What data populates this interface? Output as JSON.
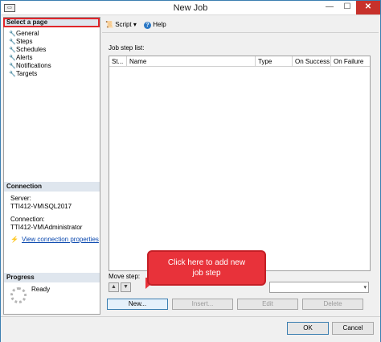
{
  "window": {
    "title": "New Job",
    "app_icon": "dialog-icon",
    "min_glyph": "—",
    "max_glyph": "☐",
    "close_glyph": "✕"
  },
  "left": {
    "select_page_header": "Select a page",
    "pages": [
      {
        "label": "General"
      },
      {
        "label": "Steps"
      },
      {
        "label": "Schedules"
      },
      {
        "label": "Alerts"
      },
      {
        "label": "Notifications"
      },
      {
        "label": "Targets"
      }
    ],
    "connection_header": "Connection",
    "server_label": "Server:",
    "server_value": "TTI412-VM\\SQL2017",
    "connection_label": "Connection:",
    "connection_value": "TTI412-VM\\Administrator",
    "view_connection_link": "View connection properties",
    "progress_header": "Progress",
    "progress_status": "Ready"
  },
  "toolbar": {
    "script_label": "Script",
    "help_label": "Help"
  },
  "steps": {
    "list_label": "Job step list:",
    "columns": [
      "St...",
      "Name",
      "Type",
      "On Success",
      "On Failure"
    ],
    "move_step_label": "Move step:",
    "buttons": {
      "new": "New...",
      "insert": "Insert...",
      "edit": "Edit",
      "delete": "Delete"
    }
  },
  "dialog": {
    "ok": "OK",
    "cancel": "Cancel"
  },
  "callout": {
    "line1": "Click here to add new",
    "line2": "job step"
  },
  "colors": {
    "accent": "#3c7fb1",
    "highlight_red": "#e0262b",
    "callout_red": "#e8323a"
  }
}
